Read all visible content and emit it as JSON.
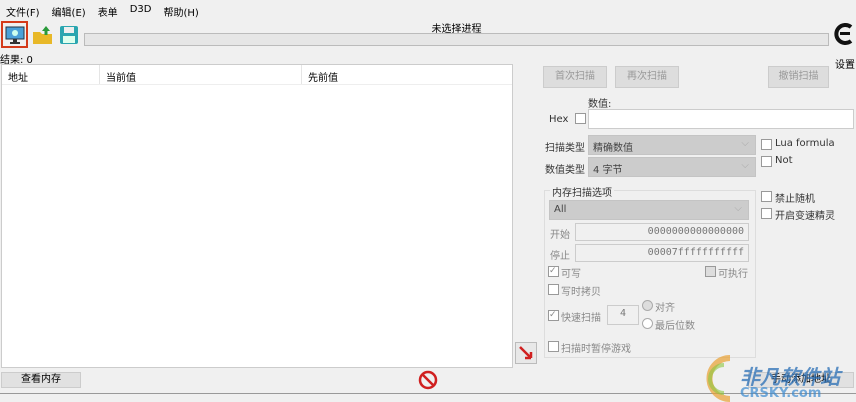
{
  "menu": [
    "文件(F)",
    "编辑(E)",
    "表单",
    "D3D",
    "帮助(H)"
  ],
  "process_title": "未选择进程",
  "settings_label": "设置",
  "results": "结果: 0",
  "columns": [
    "地址",
    "当前值",
    "先前值"
  ],
  "buttons": {
    "first_scan": "首次扫描",
    "next_scan": "再次扫描",
    "undo_scan": "撤销扫描",
    "view_memory": "查看内存",
    "add_address": "手动添加地址"
  },
  "value_label": "数值:",
  "hex_label": "Hex",
  "value_input": "",
  "scan_type_label": "扫描类型",
  "scan_type": "精确数值",
  "value_type_label": "数值类型",
  "value_type": "4 字节",
  "lua_formula": "Lua formula",
  "not_label": "Not",
  "mem_options_title": "内存扫描选项",
  "mem_region": "All",
  "start_label": "开始",
  "start_value": "0000000000000000",
  "stop_label": "停止",
  "stop_value": "00007fffffffffff",
  "writable": "可写",
  "executable": "可执行",
  "copy_on_write": "写时拷贝",
  "fast_scan": "快速扫描",
  "fast_scan_value": "4",
  "align": "对齐",
  "last_digits": "最后位数",
  "pause_game": "扫描时暂停游戏",
  "disable_random": "禁止随机",
  "speedhack": "开启变速精灵",
  "watermark": "非凡软件站",
  "watermark_sub": "CRSKY.com"
}
